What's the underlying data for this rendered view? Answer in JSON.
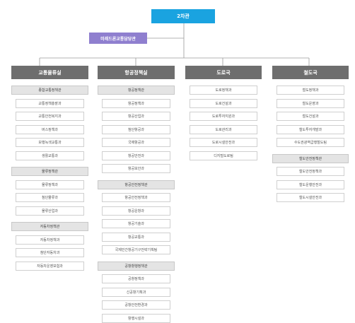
{
  "root": "2차관",
  "sub_office": "미래드론교통담당관",
  "bureaus": [
    {
      "name": "교통물류실",
      "blocks": [
        {
          "group": "종합교통정책관",
          "items": [
            "교통정책총괄과",
            "교통안전복지과",
            "버스정책과",
            "보행녹색교통과",
            "생활교통과"
          ]
        },
        {
          "group": "물류정책관",
          "items": [
            "물류정책과",
            "첨단물류과",
            "물류산업과"
          ]
        },
        {
          "group": "자동차정책관",
          "items": [
            "자동차정책과",
            "첨단자동차과",
            "자동차운영보험과"
          ]
        }
      ]
    },
    {
      "name": "항공정책실",
      "blocks": [
        {
          "group": "항공정책관",
          "items": [
            "항공정책과",
            "항공산업과",
            "첨단항공과",
            "국제항공과",
            "항공안전과",
            "항공보안과"
          ]
        },
        {
          "group": "항공안전정책관",
          "items": [
            "항공안전정책과",
            "항공운항과",
            "항공기술과",
            "항공교통과",
            "국제민간항공기구전략기획팀"
          ]
        },
        {
          "group": "공항항행정책관",
          "items": [
            "공항정책과",
            "신공항기획과",
            "공항안전환경과",
            "항행시설과"
          ]
        }
      ]
    },
    {
      "name": "도로국",
      "blocks": [
        {
          "group": null,
          "items": [
            "도로정책과",
            "도로건설과",
            "도로투자지원과",
            "도로관리과",
            "도로시설안전과",
            "디지털도로팀"
          ]
        }
      ]
    },
    {
      "name": "철도국",
      "blocks": [
        {
          "group": null,
          "items": [
            "철도정책과",
            "철도운영과",
            "철도건설과",
            "철도투자개발과",
            "수도권광역급행철도팀"
          ]
        },
        {
          "group": "철도안전정책관",
          "items": [
            "철도안전정책과",
            "철도운행안전과",
            "철도시설안전과"
          ]
        }
      ]
    }
  ]
}
